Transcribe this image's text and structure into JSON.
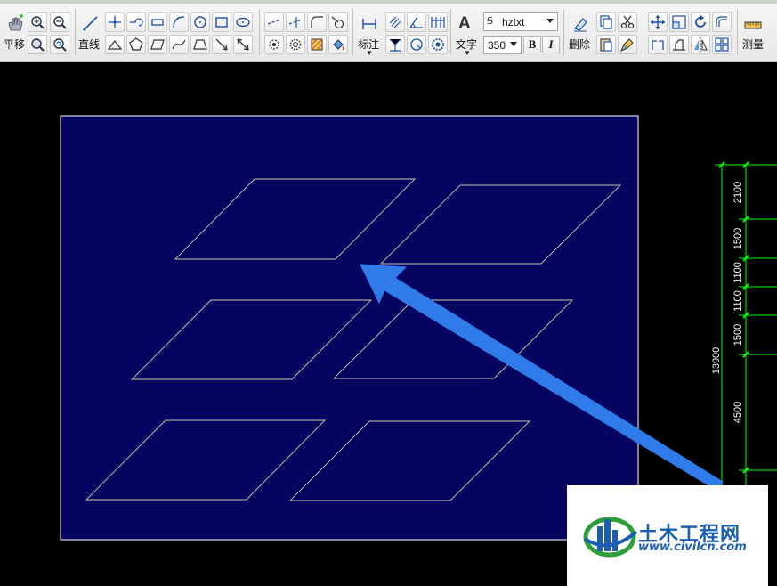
{
  "toolbar": {
    "pan_label": "平移",
    "line_label": "直线",
    "dimension_label": "标注",
    "text_label": "文字",
    "text_icon_glyph": "A",
    "delete_label": "删除",
    "measure_label": "测量",
    "font_combo_value": "hztxt",
    "size_combo_value": "350",
    "bold_label": "B",
    "italic_label": "I"
  },
  "dimensions": {
    "total": "13900",
    "segments": [
      "2100",
      "1500",
      "1100",
      "1100",
      "1500",
      "4500"
    ]
  },
  "watermark": {
    "name": "土木工程网",
    "url": "www.civilcn.com"
  },
  "colors": {
    "canvas": "#000000",
    "sheet": "#050561",
    "sheet_border": "#ffffff",
    "shape_stroke": "#c9c9a8",
    "dimension": "#00ff00",
    "arrow": "#2f7bea",
    "watermark_blue": "#1a5fb4",
    "watermark_green": "#2e9e3a"
  }
}
